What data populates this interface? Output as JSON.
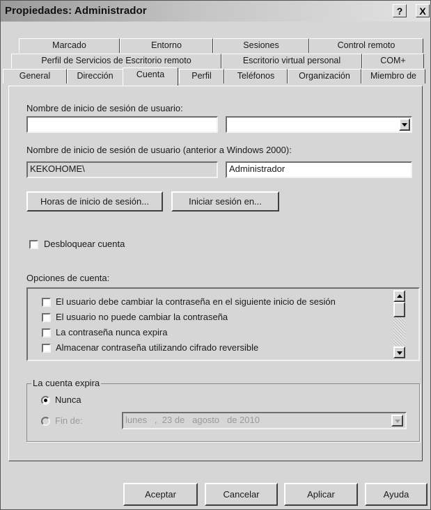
{
  "window": {
    "title": "Propiedades: Administrador",
    "help_label": "?",
    "close_label": "X"
  },
  "tabs": {
    "row1": [
      "Marcado",
      "Entorno",
      "Sesiones",
      "Control remoto"
    ],
    "row2": [
      "Perfil de Servicios de Escritorio remoto",
      "Escritorio virtual personal",
      "COM+"
    ],
    "row3": [
      "General",
      "Dirección",
      "Cuenta",
      "Perfil",
      "Teléfonos",
      "Organización",
      "Miembro de"
    ],
    "active": "Cuenta"
  },
  "account": {
    "logon_name_label": "Nombre de inicio de sesión de usuario:",
    "logon_name_value": "",
    "upn_suffix_value": "",
    "pre2000_label": "Nombre de inicio de sesión de usuario (anterior a Windows 2000):",
    "domain_value": "KEKOHOME\\",
    "pre2000_value": "Administrador",
    "logon_hours_button": "Horas de inicio de sesión...",
    "logon_to_button": "Iniciar sesión en...",
    "unlock_label": "Desbloquear cuenta",
    "unlock_checked": false,
    "options_label": "Opciones de cuenta:",
    "options": [
      {
        "label": "El usuario debe cambiar la contraseña en el siguiente inicio de sesión",
        "checked": false
      },
      {
        "label": "El usuario no puede cambiar la contraseña",
        "checked": false
      },
      {
        "label": "La contraseña nunca expira",
        "checked": false
      },
      {
        "label": "Almacenar contraseña utilizando cifrado reversible",
        "checked": false
      }
    ]
  },
  "expires": {
    "group_label": "La cuenta expira",
    "never_label": "Nunca",
    "end_of_label": "Fin de:",
    "selected": "Nunca",
    "date_value": "lunes   ,  23 de   agosto   de 2010"
  },
  "footer": {
    "ok": "Aceptar",
    "cancel": "Cancelar",
    "apply": "Aplicar",
    "help": "Ayuda"
  }
}
